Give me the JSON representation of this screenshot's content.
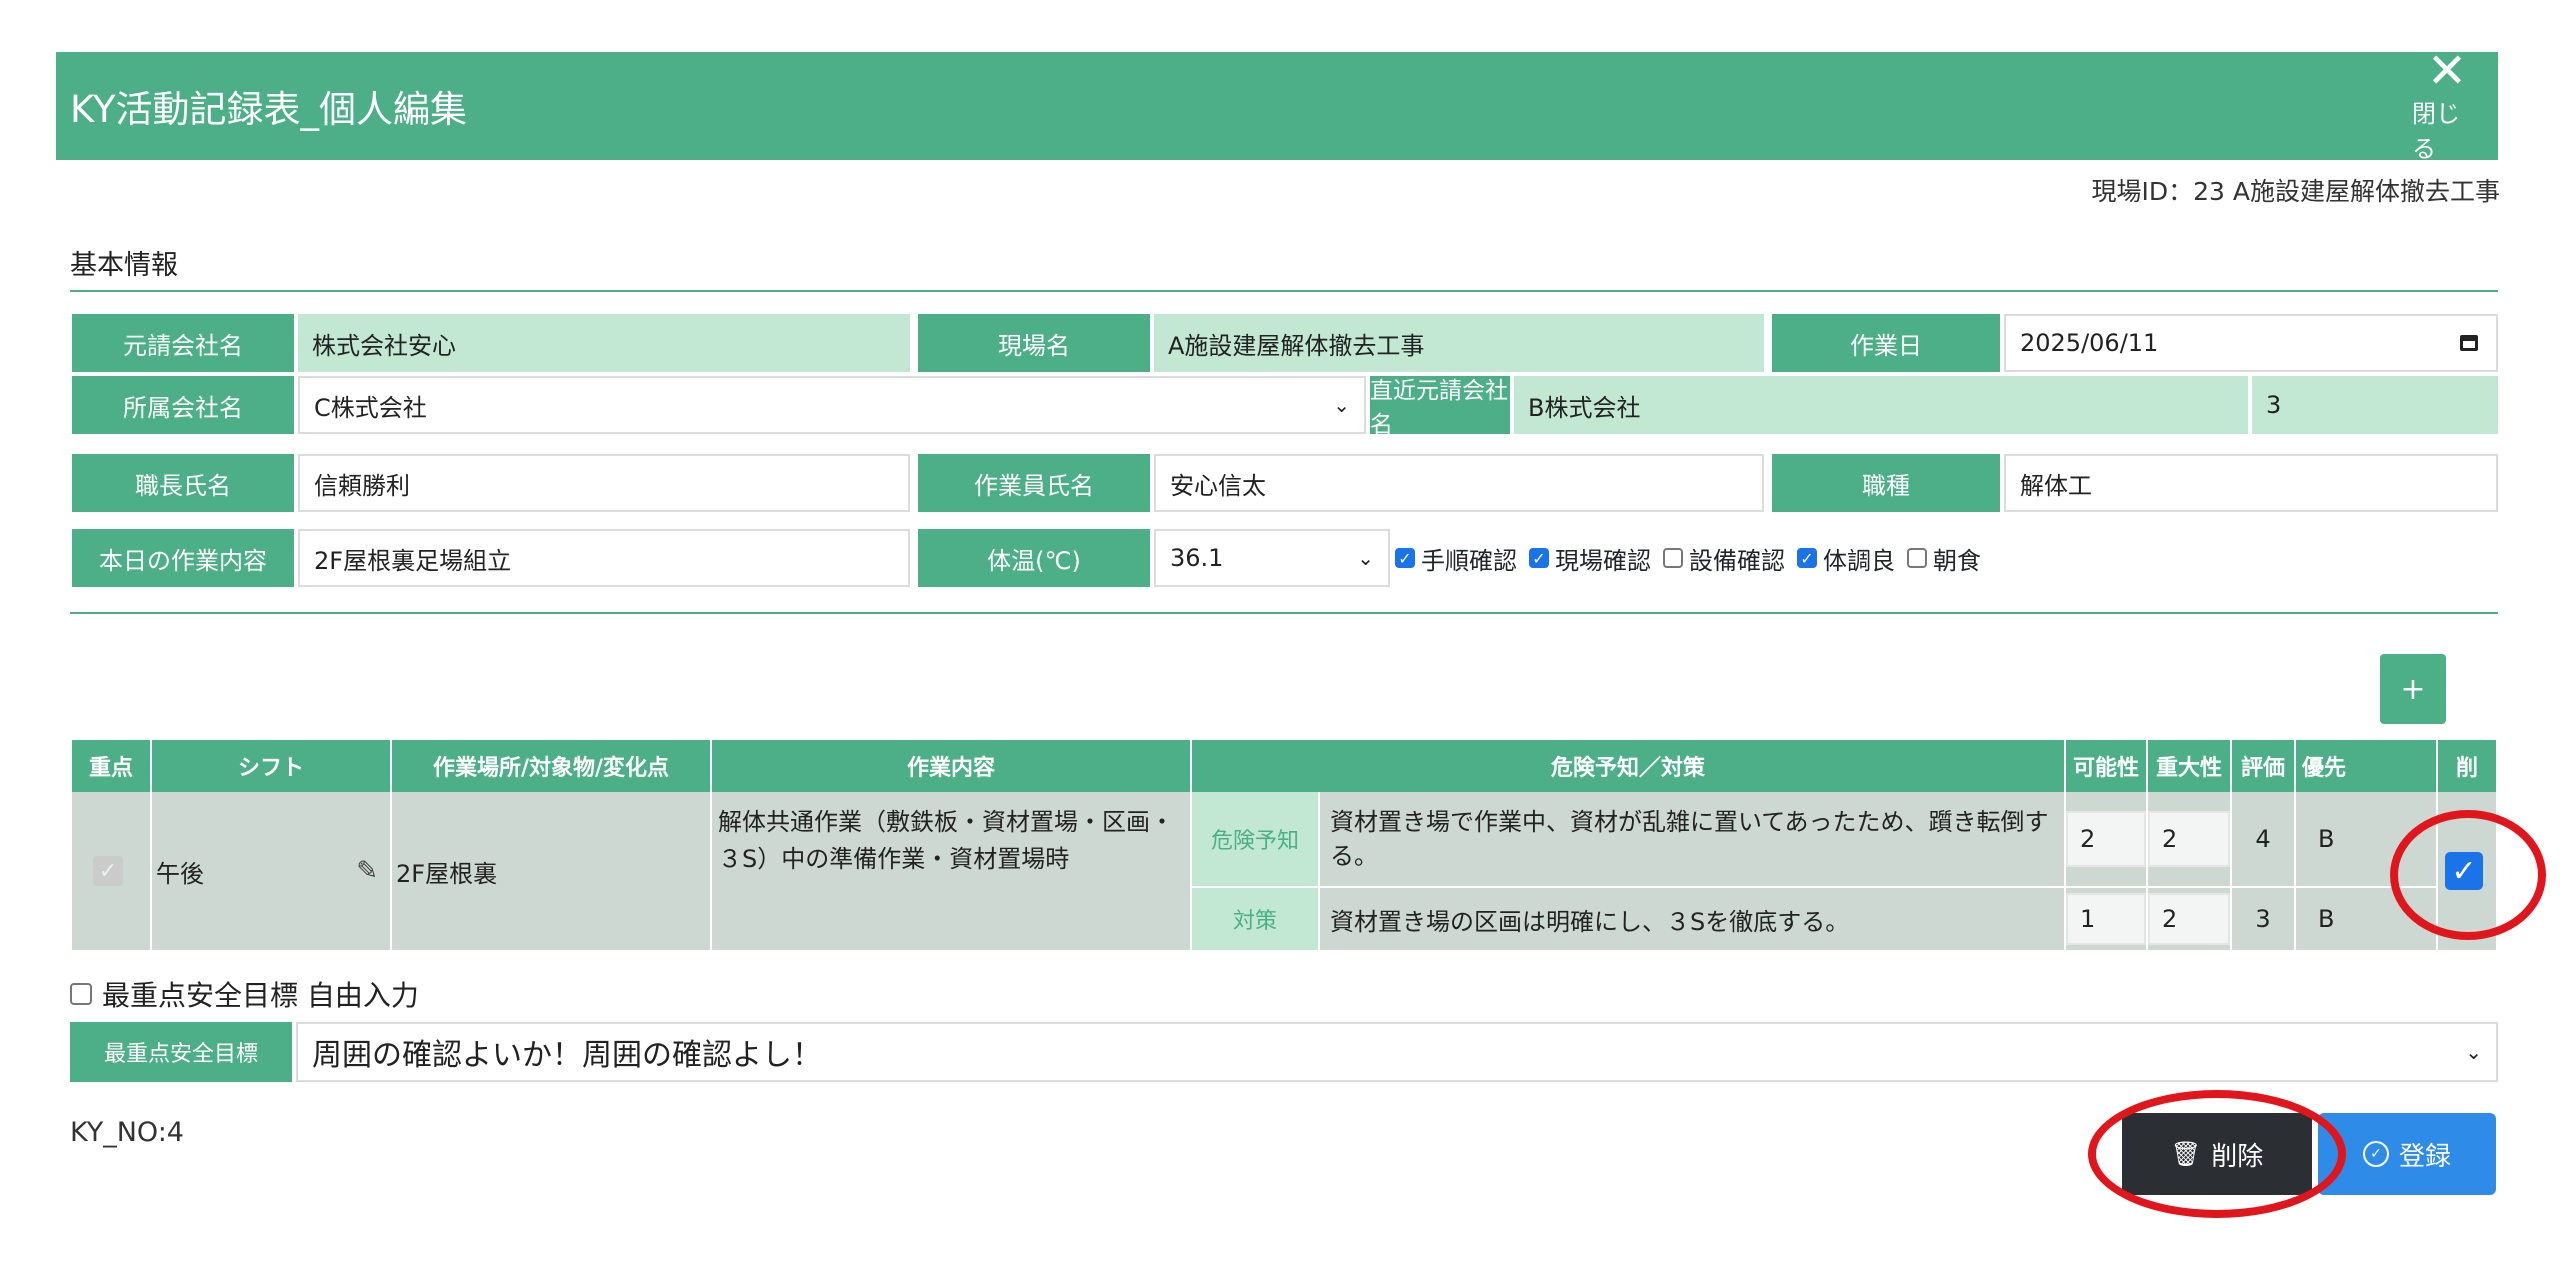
{
  "header": {
    "title": "KY活動記録表_個人編集",
    "close_label": "閉じる"
  },
  "site_id": "現場ID：23 A施設建屋解体撤去工事",
  "section_title": "基本情報",
  "info": {
    "prime_company_label": "元請会社名",
    "prime_company_value": "株式会社安心",
    "site_name_label": "現場名",
    "site_name_value": "A施設建屋解体撤去工事",
    "work_date_label": "作業日",
    "work_date_value": "2025/06/11",
    "affiliated_label": "所属会社名",
    "affiliated_value": "C株式会社",
    "direct_prime_label": "直近元請会社名",
    "direct_prime_value": "B株式会社",
    "direct_prime_num": "3",
    "foreman_label": "職長氏名",
    "foreman_value": "信頼勝利",
    "worker_label": "作業員氏名",
    "worker_value": "安心信太",
    "trade_label": "職種",
    "trade_value": "解体工",
    "today_work_label": "本日の作業内容",
    "today_work_value": "2F屋根裏足場組立",
    "temp_label": "体温(℃)",
    "temp_value": "36.1"
  },
  "checks": [
    {
      "label": "手順確認",
      "checked": true
    },
    {
      "label": "現場確認",
      "checked": true
    },
    {
      "label": "設備確認",
      "checked": false
    },
    {
      "label": "体調良",
      "checked": true
    },
    {
      "label": "朝食",
      "checked": false
    }
  ],
  "add_label": "+",
  "table": {
    "headers": {
      "focus": "重点",
      "shift": "シフト",
      "place": "作業場所/対象物/変化点",
      "work": "作業内容",
      "hazard": "危険予知／対策",
      "likelihood": "可能性",
      "severity": "重大性",
      "eval": "評価",
      "priority": "優先",
      "del": "削"
    },
    "row": {
      "shift": "午後",
      "place": "2F屋根裏",
      "work": "解体共通作業（敷鉄板・資材置場・区画・３S）中の準備作業・資材置場時",
      "danger_label": "危険予知",
      "danger_text": "資材置き場で作業中、資材が乱雑に置いてあったため、躓き転倒する。",
      "measure_label": "対策",
      "measure_text": "資材置き場の区画は明確にし、３Sを徹底する。",
      "danger_likelihood": "2",
      "danger_severity": "2",
      "danger_eval": "4",
      "danger_priority": "B",
      "measure_likelihood": "1",
      "measure_severity": "2",
      "measure_eval": "3",
      "measure_priority": "B"
    }
  },
  "free_input_label": "最重点安全目標 自由入力",
  "goal": {
    "label": "最重点安全目標",
    "value": "周囲の確認よいか！周囲の確認よし！"
  },
  "ky_no": "KY_NO:4",
  "buttons": {
    "delete": "削除",
    "register": "登録"
  },
  "colors": {
    "primary": "#4caf87",
    "highlight": "#e0161c",
    "check": "#1a73e8"
  }
}
